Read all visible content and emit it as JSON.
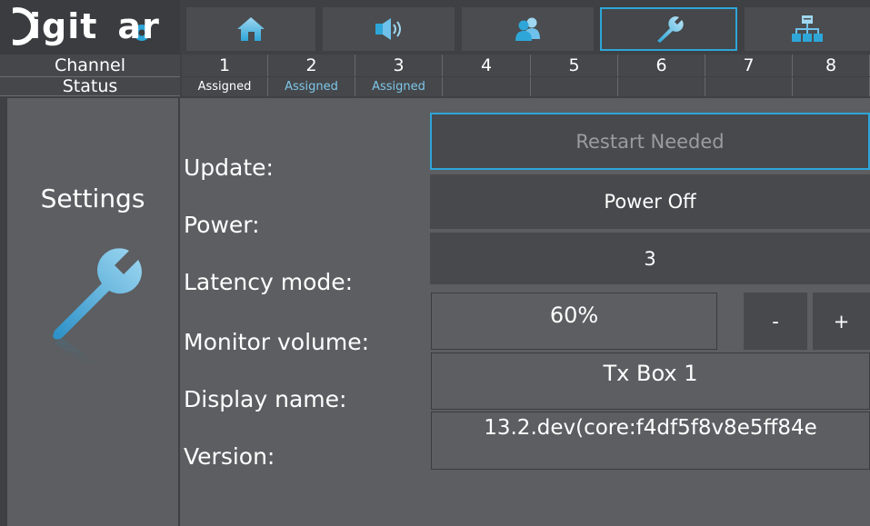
{
  "logo": {
    "text": "Digitear"
  },
  "nav": {
    "tabs": [
      {
        "id": "home",
        "icon": "home-icon"
      },
      {
        "id": "audio",
        "icon": "speaker-icon"
      },
      {
        "id": "users",
        "icon": "users-icon"
      },
      {
        "id": "settings",
        "icon": "wrench-icon",
        "active": true
      },
      {
        "id": "network",
        "icon": "network-icon"
      }
    ]
  },
  "channels": {
    "channel_label": "Channel",
    "status_label": "Status",
    "numbers": [
      "1",
      "2",
      "3",
      "4",
      "5",
      "6",
      "7",
      "8"
    ],
    "statuses": [
      "Assigned",
      "Assigned",
      "Assigned",
      "",
      "",
      "",
      "",
      ""
    ]
  },
  "side": {
    "title": "Settings",
    "icon": "wrench-icon"
  },
  "settings": {
    "labels": {
      "update": "Update:",
      "power": "Power:",
      "latency": "Latency mode:",
      "monitor_volume": "Monitor volume:",
      "display_name": "Display name:",
      "version": "Version:"
    },
    "update_button": "Restart Needed",
    "power_button": "Power Off",
    "latency_value": "3",
    "monitor_volume_value": "60%",
    "volume_minus": "-",
    "volume_plus": "+",
    "display_name_value": "Tx Box 1",
    "version_value": "13.2.dev(core:f4df5f8v8e5ff84e"
  },
  "colors": {
    "accent": "#2ea6d8",
    "status_active": "#7ec7ea",
    "status_default": "#ffffff"
  }
}
